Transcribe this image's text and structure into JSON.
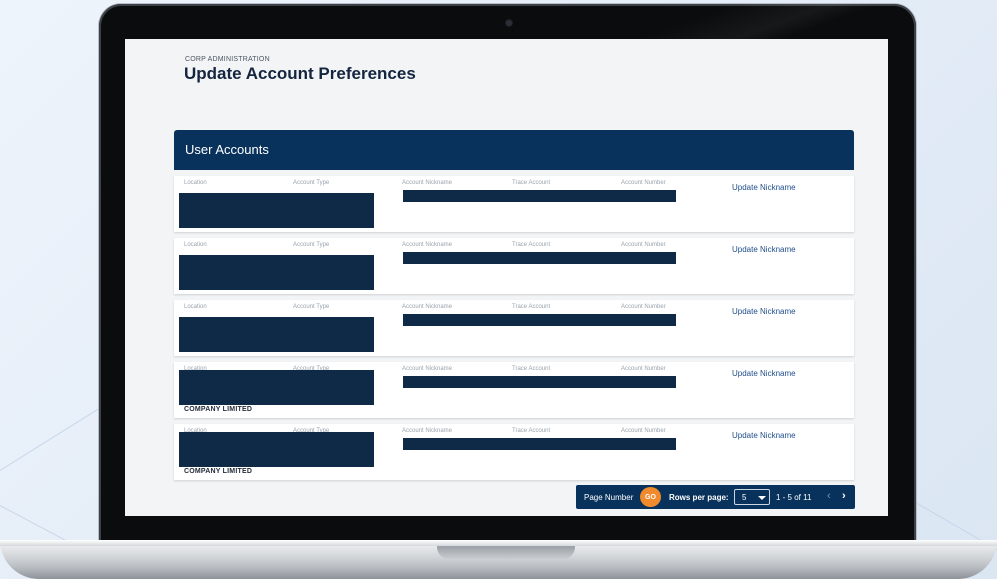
{
  "header": {
    "breadcrumb": "CORP ADMINISTRATION",
    "title": "Update Account Preferences"
  },
  "panel": {
    "title": "User Accounts"
  },
  "columns": [
    "Location",
    "Account Type",
    "Account Nickname",
    "Trace Account",
    "Account Number"
  ],
  "rows": [
    {
      "visible_text": "",
      "action": "Update Nickname"
    },
    {
      "visible_text": "",
      "action": "Update Nickname"
    },
    {
      "visible_text": "",
      "action": "Update Nickname"
    },
    {
      "visible_text": "COMPANY LIMITED",
      "action": "Update Nickname"
    },
    {
      "visible_text": "COMPANY LIMITED",
      "action": "Update Nickname"
    }
  ],
  "pagination": {
    "page_number_label": "Page Number",
    "go_label": "GO",
    "rows_per_page_label": "Rows per page:",
    "rows_per_page_value": "5",
    "range_text": "1 - 5 of 11",
    "prev_icon": "‹",
    "next_icon": "›"
  },
  "colors": {
    "header_navy": "#08325c",
    "redaction": "#0e2a47",
    "go_orange": "#f08a2c",
    "link_blue": "#1f4e8c"
  },
  "icons": [
    "chevron-down-icon",
    "chevron-left-icon",
    "chevron-right-icon",
    "camera-icon"
  ]
}
